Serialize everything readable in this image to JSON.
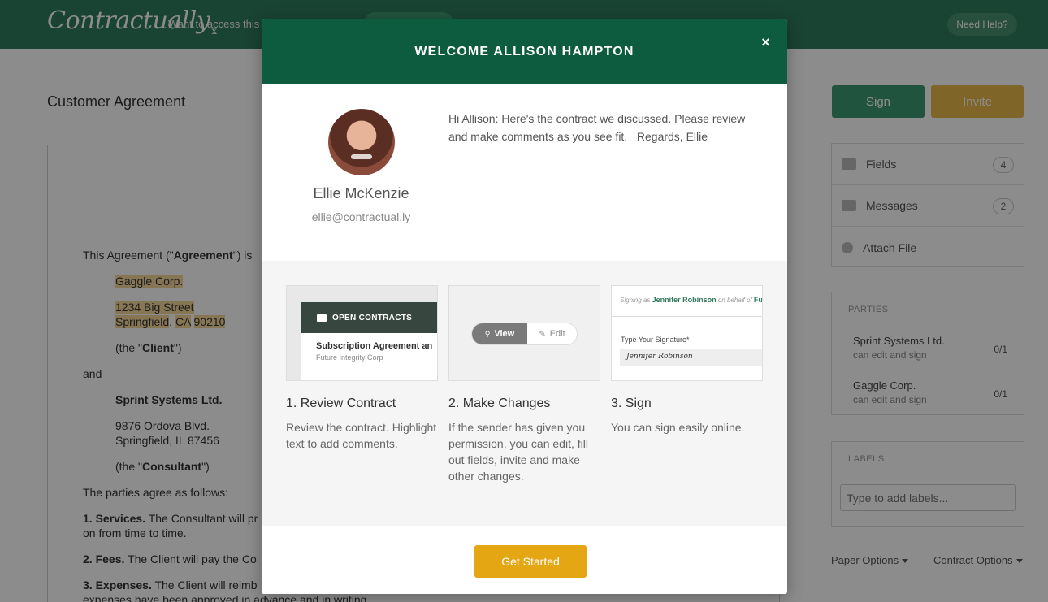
{
  "header": {
    "logo": "Contractually",
    "logo_mark": "x",
    "promo_text": "Want to access this",
    "help_label": "Need Help?"
  },
  "page": {
    "title": "Customer Agreement",
    "sign_label": "Sign",
    "invite_label": "Invite"
  },
  "document": {
    "line1_pre": "This Agreement (\"",
    "line1_bold": "Agreement",
    "line1_post": "\") is",
    "client_name": "Gaggle Corp.",
    "client_street": "1234 Big Street",
    "client_city": "Springfield",
    "client_state": "CA",
    "client_zip": "90210",
    "client_role_pre": "(the \"",
    "client_role": "Client",
    "client_role_post": "\")",
    "and": "and",
    "consultant_name": "Sprint Systems Ltd.",
    "consultant_street": "9876 Ordova Blvd.",
    "consultant_city": "Springfield, IL 87456",
    "consultant_role_pre": "(the \"",
    "consultant_role": "Consultant",
    "consultant_role_post": "\")",
    "parties_agree": "The parties agree as follows:",
    "services_head": "1. Services.",
    "services_text": " The Consultant will pr",
    "services_cont": "on from time to time.",
    "fees_head": "2. Fees.",
    "fees_text": " The Client will pay the Co",
    "expenses_head": "3. Expenses.",
    "expenses_text": " The Client will reimb",
    "expenses_cont": "expenses have been approved in advance and in writing."
  },
  "sidebar": {
    "items": [
      {
        "label": "Fields",
        "count": "4",
        "icon": "tag-icon"
      },
      {
        "label": "Messages",
        "count": "2",
        "icon": "envelope-icon"
      },
      {
        "label": "Attach File",
        "icon": "upload-icon"
      }
    ],
    "parties_heading": "PARTIES",
    "parties": [
      {
        "name": "Sprint Systems Ltd.",
        "role": "can edit and sign",
        "progress": "0/1"
      },
      {
        "name": "Gaggle Corp.",
        "role": "can edit and sign",
        "progress": "0/1"
      }
    ],
    "labels_heading": "LABELS",
    "labels_placeholder": "Type to add labels...",
    "paper_options": "Paper Options",
    "contract_options": "Contract Options"
  },
  "modal": {
    "title": "WELCOME ALLISON HAMPTON",
    "close_glyph": "×",
    "sender_name": "Ellie McKenzie",
    "sender_email": "ellie@contractual.ly",
    "message": "Hi Allison: Here's the contract we discussed. Please review and make comments as you see fit.   Regards, Ellie",
    "steps": [
      {
        "title": "1. Review Contract",
        "desc": "Review the contract. Highlight text to add comments."
      },
      {
        "title": "2. Make Changes",
        "desc": "If the sender has given you permission, you can edit, fill out fields, invite and make other changes."
      },
      {
        "title": "3. Sign",
        "desc": "You can sign easily online."
      }
    ],
    "thumb1": {
      "bar": "OPEN CONTRACTS",
      "line1": "Subscription Agreement an",
      "line2": "Future Integrity Corp"
    },
    "thumb2": {
      "view": "View",
      "edit": "Edit"
    },
    "thumb3": {
      "signing_as": "Signing as",
      "signer": "Jennifer Robinson",
      "on_behalf": "on behalf of",
      "org": "Future",
      "label": "Type Your Signature*",
      "signature": "Jennifer Robinson"
    },
    "cta_label": "Get Started"
  },
  "colors": {
    "header": "#2f7a5c",
    "modal_header": "#0d5c3f",
    "cta": "#e5a614",
    "sign": "#3d9a72",
    "invite": "#e8b84a"
  }
}
